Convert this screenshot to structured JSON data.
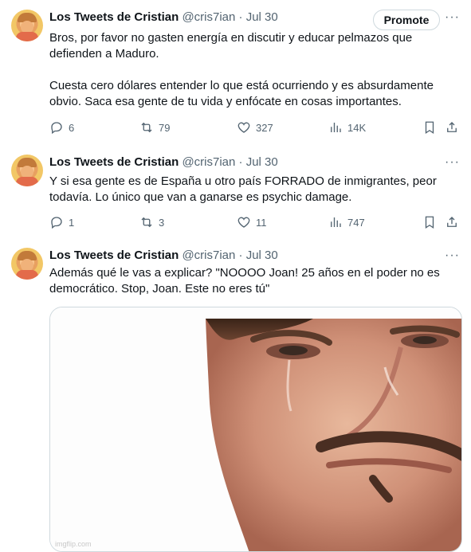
{
  "tweets": [
    {
      "author": "Los Tweets de Cristian",
      "handle": "@cris7ian",
      "sep": "·",
      "date": "Jul 30",
      "promote": "Promote",
      "text": "Bros, por favor no gasten energía en discutir y educar pelmazos que defienden a Maduro.\n\nCuesta cero dólares entender lo que está ocurriendo y es absurdamente obvio. Saca esa gente de tu vida y enfócate en cosas importantes.",
      "replies": "6",
      "reposts": "79",
      "likes": "327",
      "views": "14K"
    },
    {
      "author": "Los Tweets de Cristian",
      "handle": "@cris7ian",
      "sep": "·",
      "date": "Jul 30",
      "text": "Y si esa gente es de España u otro país FORRADO de inmigrantes, peor todavía. Lo único que van a ganarse es psychic damage.",
      "replies": "1",
      "reposts": "3",
      "likes": "11",
      "views": "747"
    },
    {
      "author": "Los Tweets de Cristian",
      "handle": "@cris7ian",
      "sep": "·",
      "date": "Jul 30",
      "text": "Además qué le vas a explicar? \"NOOOO Joan! 25 años en el poder no es democrático. Stop, Joan. Este no eres tú\"",
      "media_watermark": "imgflip.com"
    }
  ],
  "icons": {
    "more": "more-icon",
    "reply": "reply-icon",
    "repost": "repost-icon",
    "like": "like-icon",
    "views": "views-icon",
    "bookmark": "bookmark-icon",
    "share": "share-icon"
  },
  "colors": {
    "text": "#0f1419",
    "secondary": "#536471",
    "border": "#cfd9de"
  }
}
